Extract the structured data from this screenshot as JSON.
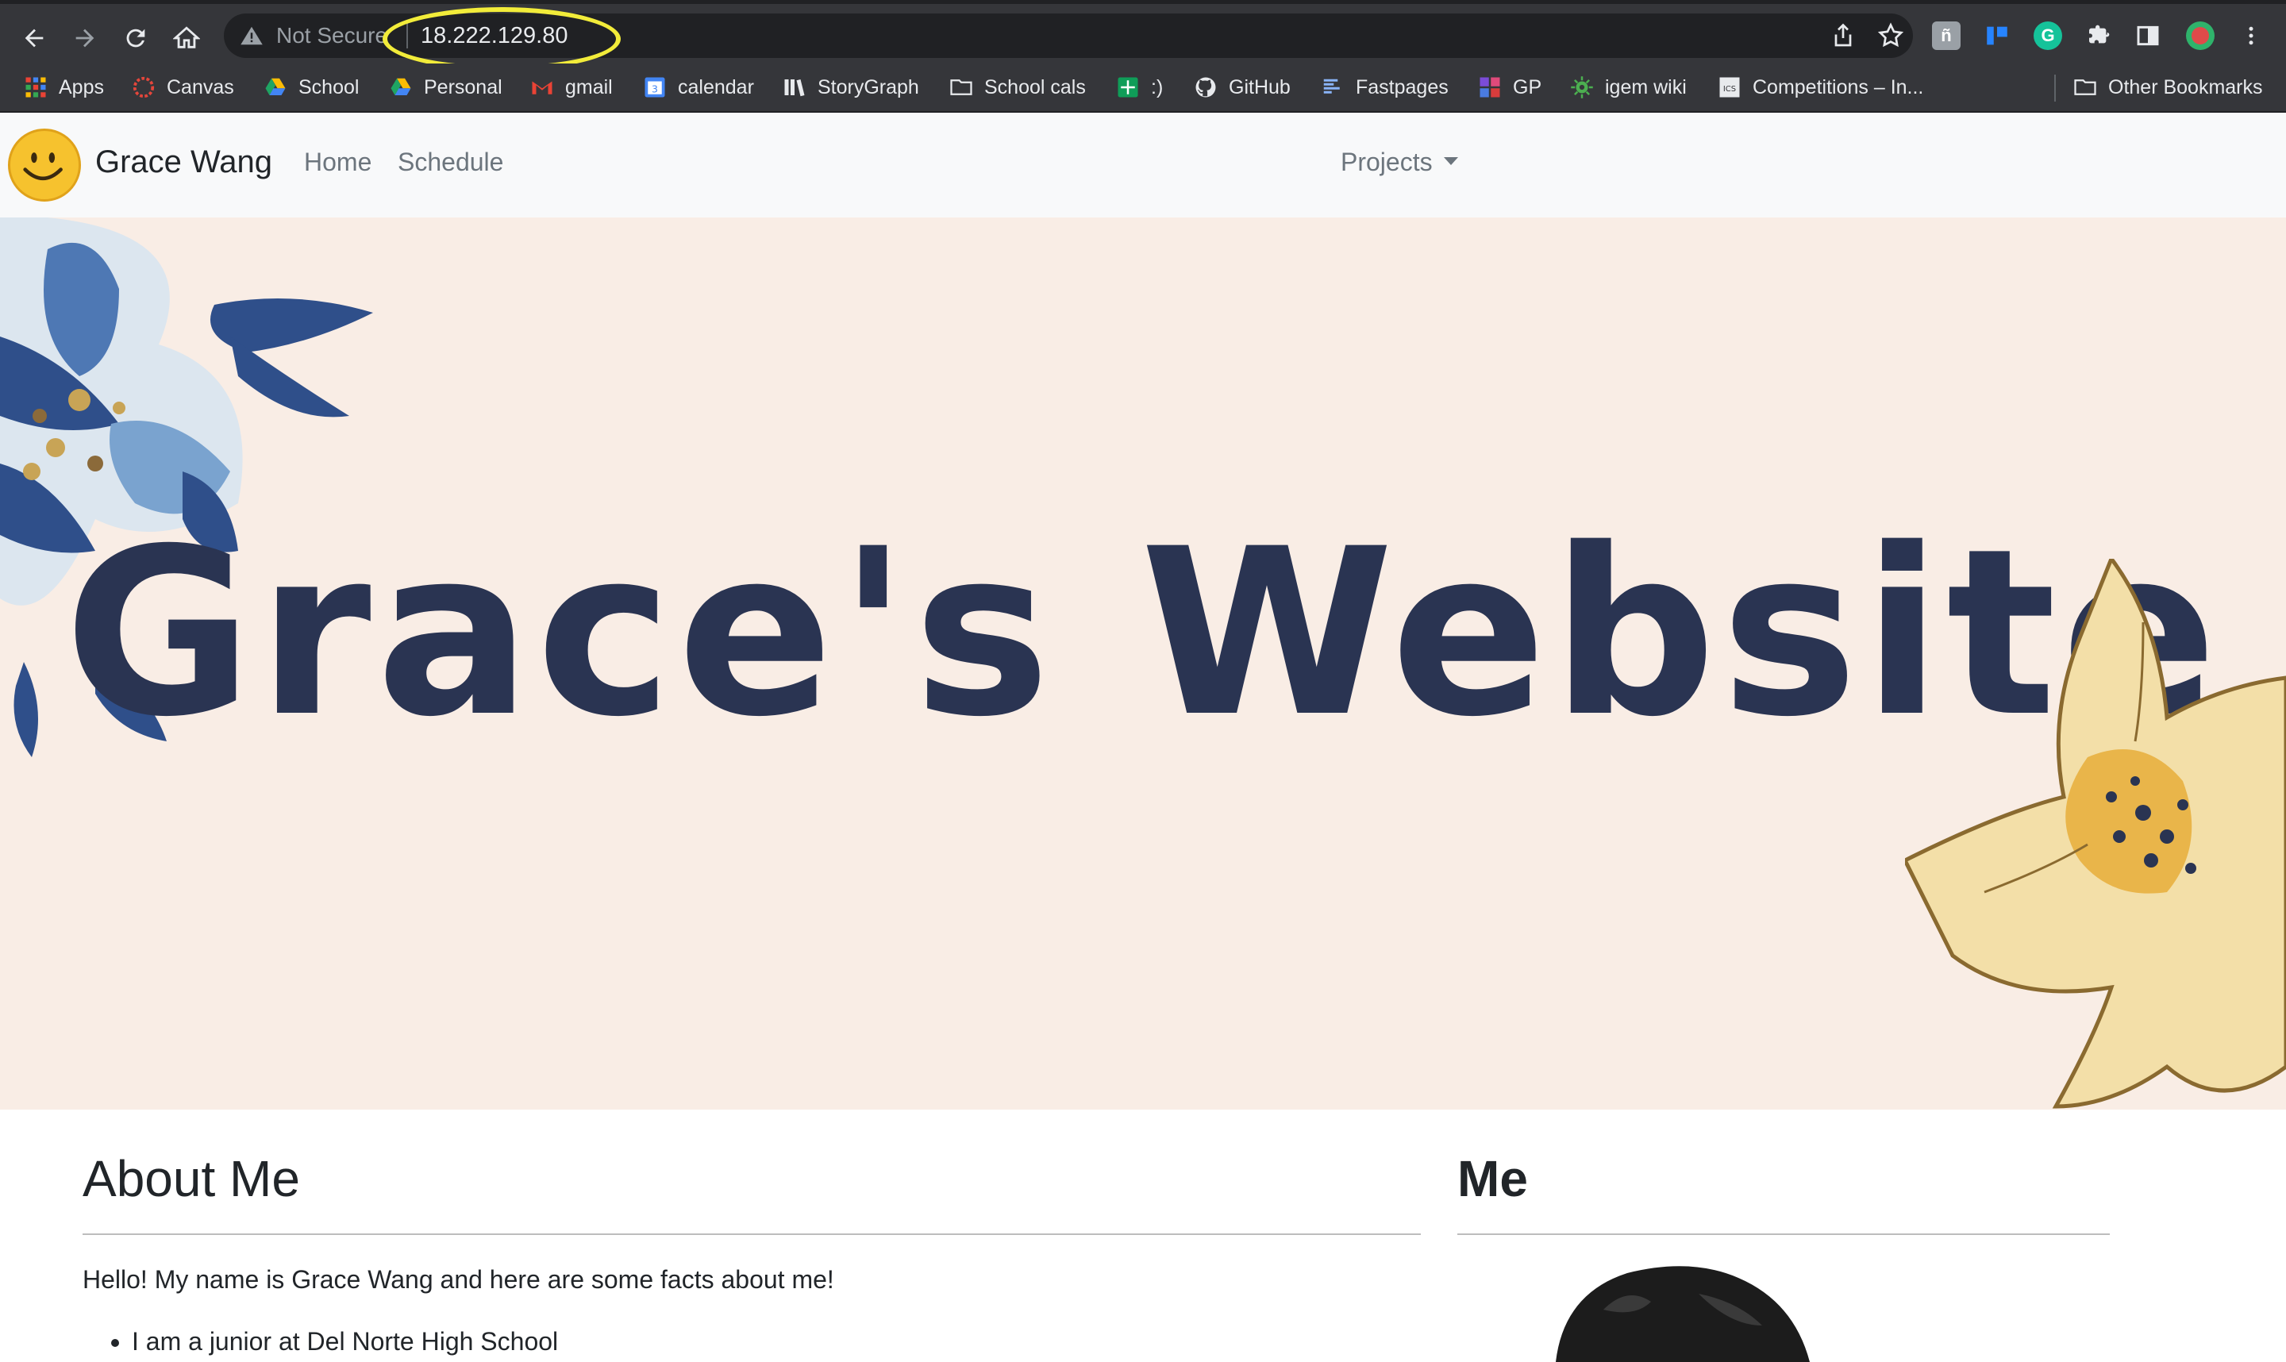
{
  "browser": {
    "security_label": "Not Secure",
    "url": "18.222.129.80"
  },
  "bookmarks": [
    {
      "label": "Apps",
      "icon": "apps-grid-icon"
    },
    {
      "label": "Canvas",
      "icon": "canvas-icon"
    },
    {
      "label": "School",
      "icon": "google-drive-icon"
    },
    {
      "label": "Personal",
      "icon": "google-drive-icon"
    },
    {
      "label": "gmail",
      "icon": "gmail-icon"
    },
    {
      "label": "calendar",
      "icon": "calendar-icon"
    },
    {
      "label": "StoryGraph",
      "icon": "storygraph-icon"
    },
    {
      "label": "School cals",
      "icon": "folder-icon"
    },
    {
      "label": ":)",
      "icon": "sheets-icon"
    },
    {
      "label": "GitHub",
      "icon": "github-icon"
    },
    {
      "label": "Fastpages",
      "icon": "fastpages-icon"
    },
    {
      "label": "GP",
      "icon": "gp-icon"
    },
    {
      "label": "igem wiki",
      "icon": "gear-icon"
    },
    {
      "label": "Competitions – In...",
      "icon": "ics-icon"
    }
  ],
  "other_bookmarks": "Other Bookmarks",
  "site": {
    "brand": "Grace Wang",
    "nav": {
      "home": "Home",
      "schedule": "Schedule",
      "projects": "Projects"
    },
    "hero_title": "Grace's Website",
    "about": {
      "heading": "About Me",
      "intro": "Hello! My name is Grace Wang and here are some facts about me!",
      "facts": [
        "I am a junior at Del Norte High School"
      ]
    },
    "me": {
      "heading": "Me"
    }
  },
  "colors": {
    "hero_bg": "#f9ede5",
    "hero_text": "#2a3452",
    "url_highlight": "#f2ec3a"
  }
}
